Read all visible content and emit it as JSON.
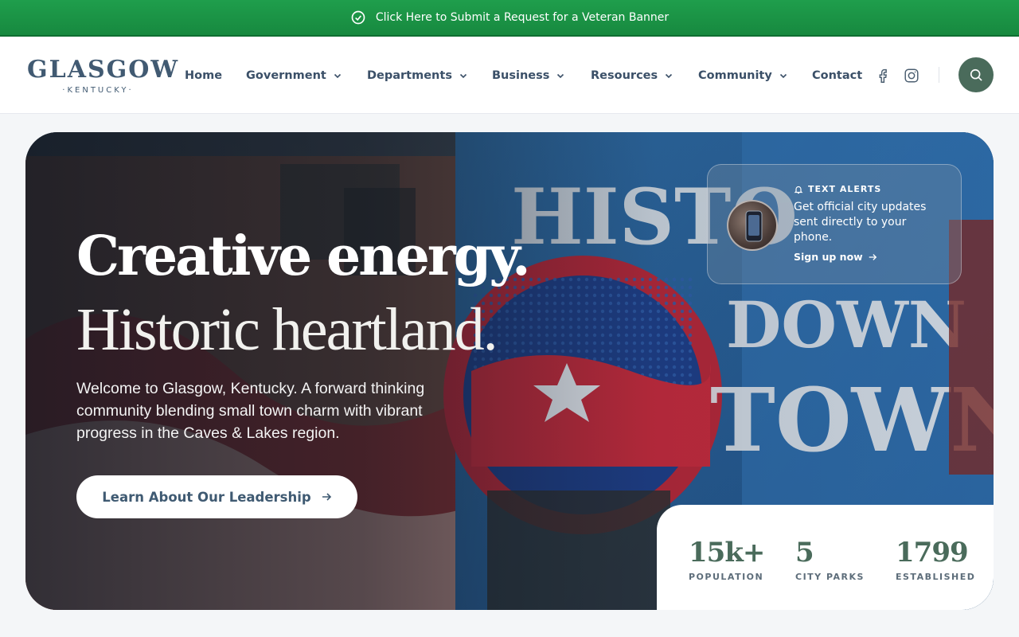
{
  "announcement": {
    "text": "Click Here to Submit a Request for a Veteran Banner",
    "icon": "check-circle-icon"
  },
  "logo": {
    "name": "GLASGOW",
    "state": "·KENTUCKY·"
  },
  "nav": {
    "items": [
      {
        "label": "Home",
        "dropdown": false
      },
      {
        "label": "Government",
        "dropdown": true
      },
      {
        "label": "Departments",
        "dropdown": true
      },
      {
        "label": "Business",
        "dropdown": true
      },
      {
        "label": "Resources",
        "dropdown": true
      },
      {
        "label": "Community",
        "dropdown": true
      },
      {
        "label": "Contact",
        "dropdown": false
      }
    ],
    "social": [
      "facebook-icon",
      "instagram-icon"
    ],
    "search_icon": "search-icon"
  },
  "hero": {
    "headline_1": "Creative energy.",
    "headline_2": "Historic heartland.",
    "intro": "Welcome to Glasgow, Kentucky. A forward thinking community blending small town charm with vibrant progress in the Caves & Lakes region.",
    "cta_label": "Learn About Our Leadership"
  },
  "alert": {
    "title": "TEXT ALERTS",
    "description": "Get official city updates sent directly to your phone.",
    "link": "Sign up now"
  },
  "stats": [
    {
      "value": "15k+",
      "label": "POPULATION"
    },
    {
      "value": "5",
      "label": "CITY PARKS"
    },
    {
      "value": "1799",
      "label": "ESTABLISHED"
    }
  ],
  "colors": {
    "banner_green": "#1f9e4c",
    "brand_green": "#4a6b5b",
    "nav_text": "#3b5068"
  }
}
